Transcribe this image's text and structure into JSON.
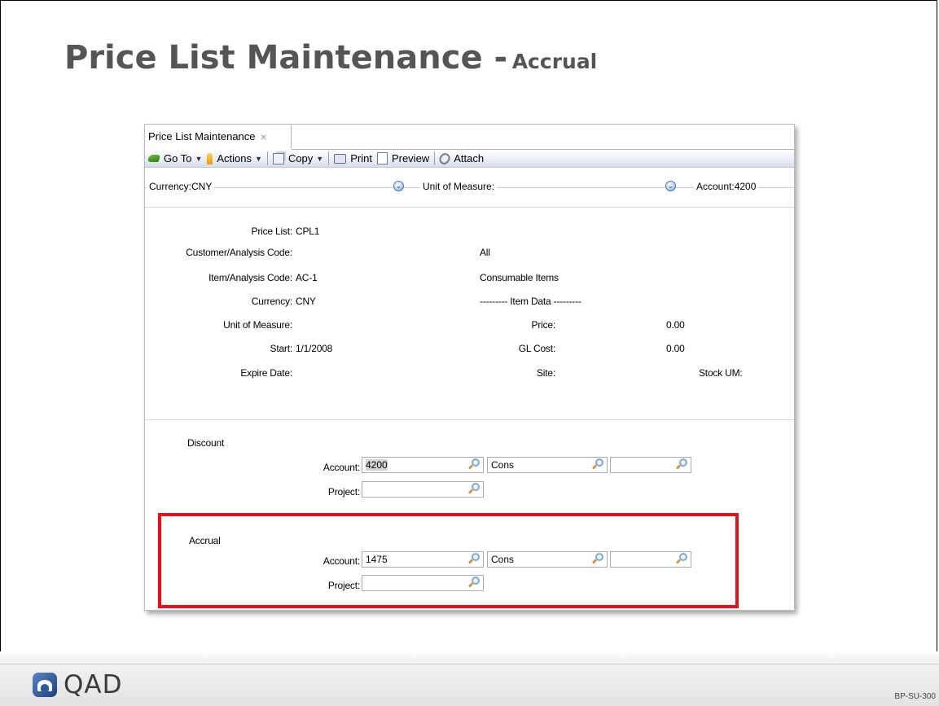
{
  "slide": {
    "title": "Price List Maintenance -",
    "subtitle": "Accrual",
    "code": "BP-SU-300",
    "logo_text": "QAD"
  },
  "window": {
    "tab_label": "Price List Maintenance",
    "tab_close": "×",
    "toolbar": {
      "goto": "Go To",
      "actions": "Actions",
      "copy": "Copy",
      "print": "Print",
      "preview": "Preview",
      "attach": "Attach",
      "dropdown_arrow": "▼"
    },
    "filters": {
      "currency": "Currency:CNY",
      "unit_of_measure": "Unit of Measure:",
      "account": "Account:4200",
      "chevron": "⌄"
    },
    "details": {
      "price_list_label": "Price List:",
      "price_list_value": "CPL1",
      "customer_label": "Customer/Analysis Code:",
      "customer_value": "All",
      "item_label": "Item/Analysis Code:",
      "item_value": "AC-1",
      "item_desc": "Consumable Items",
      "currency_label": "Currency:",
      "currency_value": "CNY",
      "item_data_header": "--------- Item Data ---------",
      "uom_label": "Unit of Measure:",
      "price_label": "Price:",
      "price_value": "0.00",
      "start_label": "Start:",
      "start_value": "1/1/2008",
      "gl_cost_label": "GL Cost:",
      "gl_cost_value": "0.00",
      "expire_label": "Expire Date:",
      "site_label": "Site:",
      "stock_um_label": "Stock UM:"
    },
    "discount": {
      "header": "Discount",
      "account_label": "Account:",
      "account_value": "4200",
      "sub_value": "Cons",
      "cc_value": "",
      "project_label": "Project:",
      "project_value": ""
    },
    "accrual": {
      "header": "Accrual",
      "account_label": "Account:",
      "account_value": "1475",
      "sub_value": "Cons",
      "cc_value": "",
      "project_label": "Project:",
      "project_value": ""
    }
  },
  "colors": {
    "highlight": "#e8101b",
    "title": "#555555"
  }
}
